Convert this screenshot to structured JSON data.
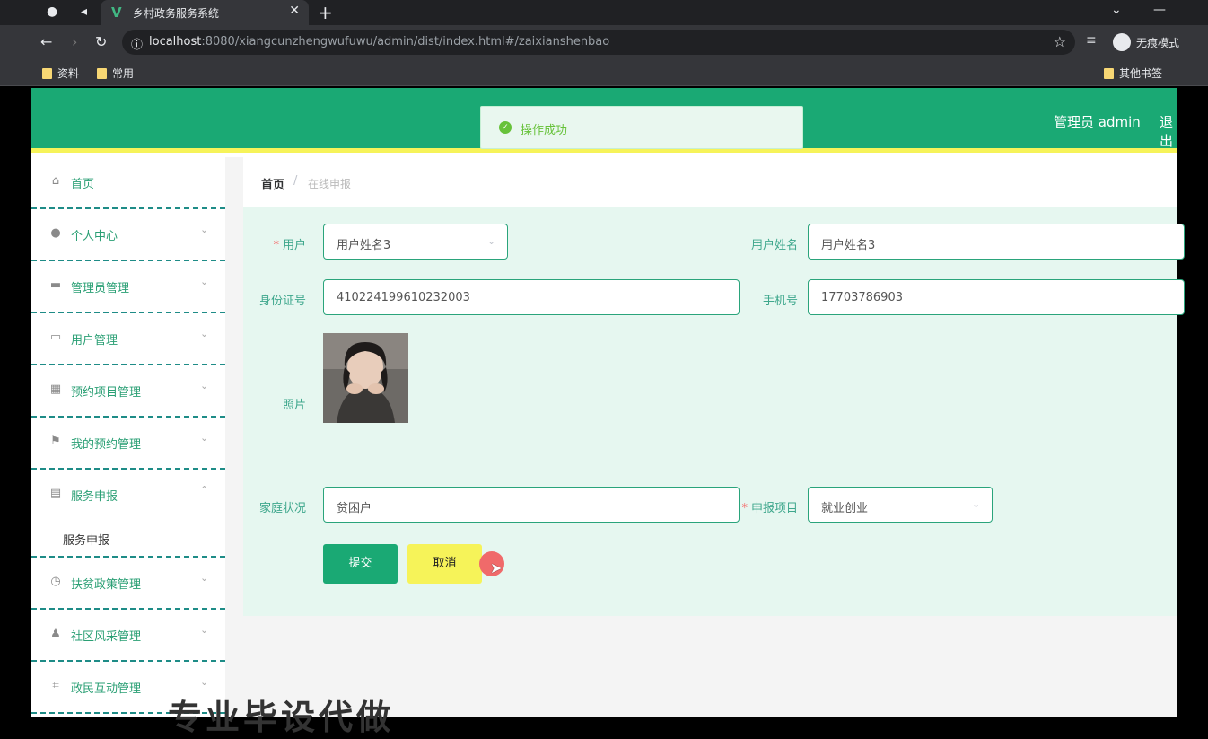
{
  "browser": {
    "tab_title": "乡村政务服务系统",
    "url_host": "localhost",
    "url_rest": ":8080/xiangcunzhengwufuwu/admin/dist/index.html#/zaixianshenbao",
    "incognito_label": "无痕模式",
    "bookmarks": [
      "资料",
      "常用"
    ],
    "other_bookmarks": "其他书签"
  },
  "header": {
    "user_text": "管理员 admin",
    "logout_text": "退出"
  },
  "toast": {
    "text": "操作成功"
  },
  "sidebar": {
    "items": [
      {
        "label": "首页",
        "icon": "home-icon"
      },
      {
        "label": "个人中心",
        "icon": "user-icon"
      },
      {
        "label": "管理员管理",
        "icon": "printer-icon"
      },
      {
        "label": "用户管理",
        "icon": "card-icon"
      },
      {
        "label": "预约项目管理",
        "icon": "grid-icon"
      },
      {
        "label": "我的预约管理",
        "icon": "flag-icon"
      },
      {
        "label": "服务申报",
        "icon": "table-icon"
      },
      {
        "label": "扶贫政策管理",
        "icon": "clock-icon"
      },
      {
        "label": "社区风采管理",
        "icon": "person-icon"
      },
      {
        "label": "政民互动管理",
        "icon": "crop-icon"
      }
    ],
    "submenu": "服务申报"
  },
  "breadcrumb": {
    "home": "首页",
    "separator": "/",
    "current": "在线申报"
  },
  "form": {
    "user_label": "用户",
    "user_value": "用户姓名3",
    "name_label": "用户姓名",
    "name_value": "用户姓名3",
    "id_label": "身份证号",
    "id_value": "410224199610232003",
    "phone_label": "手机号",
    "phone_value": "17703786903",
    "photo_label": "照片",
    "family_label": "家庭状况",
    "family_value": "贫困户",
    "project_label": "申报项目",
    "project_value": "就业创业",
    "submit_label": "提交",
    "cancel_label": "取消"
  },
  "watermark": "专业毕设代做",
  "colors": {
    "primary": "#1aa974",
    "accent": "#f6f359",
    "form_bg": "#e6f7f0"
  }
}
